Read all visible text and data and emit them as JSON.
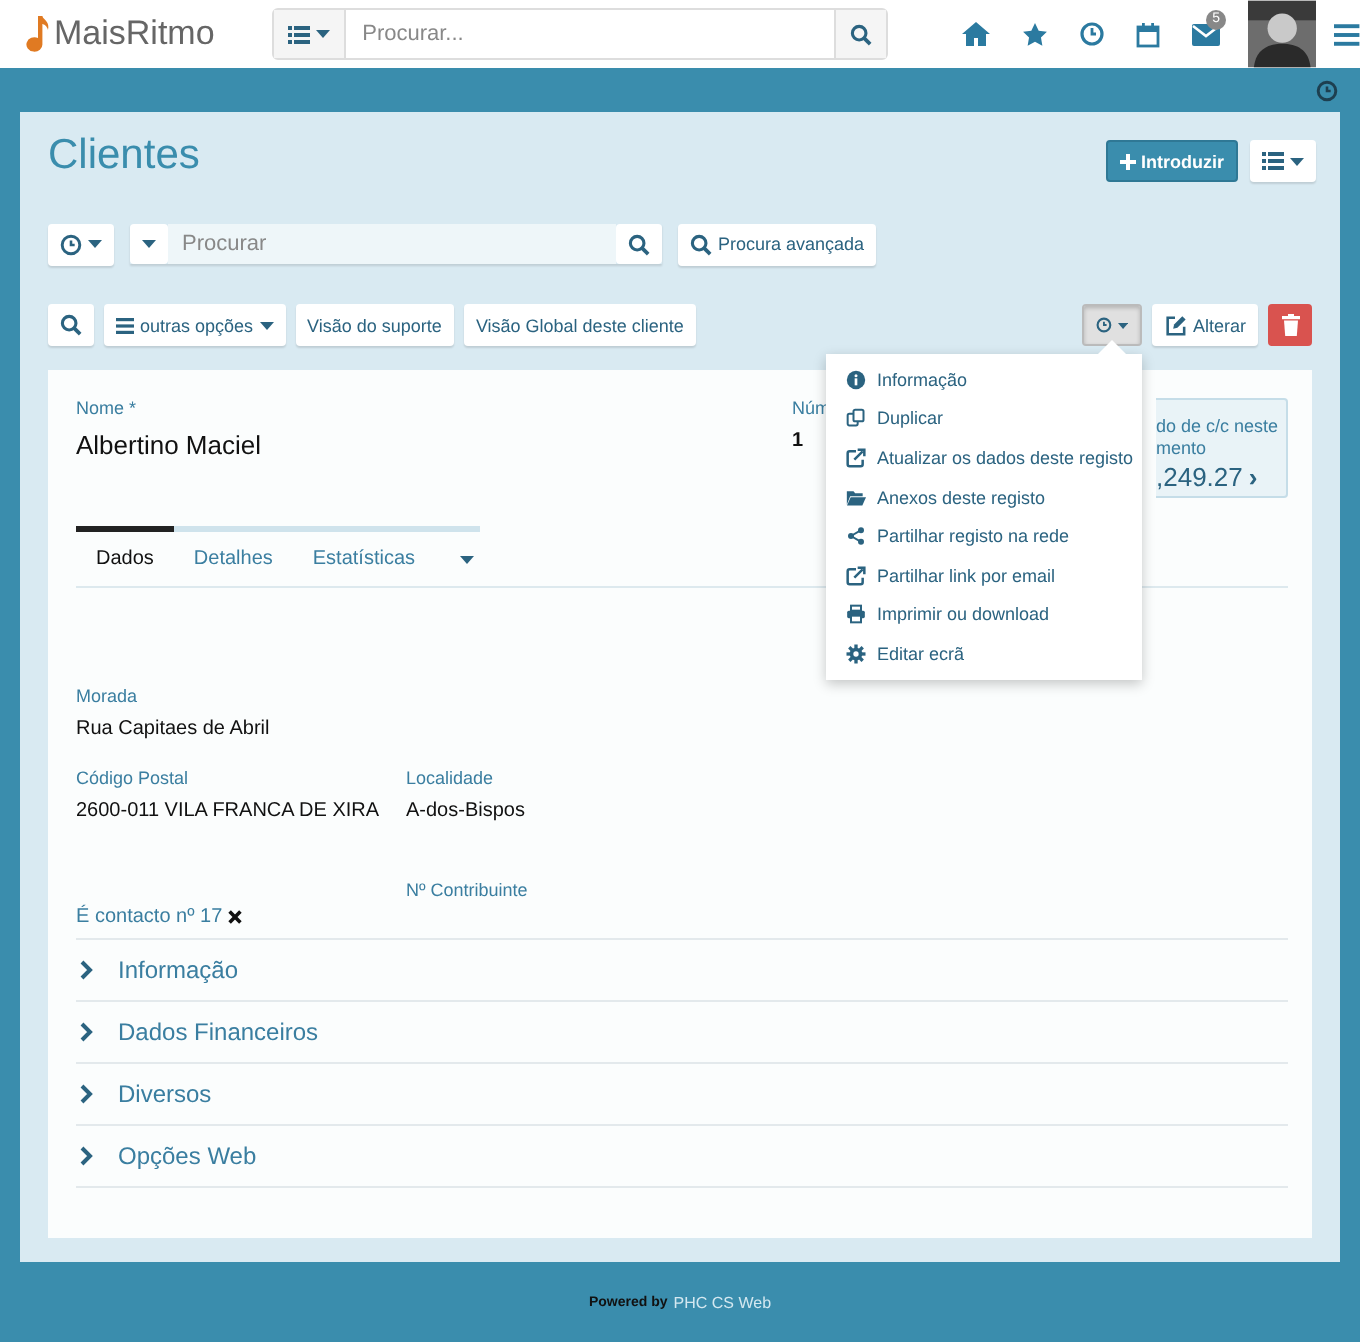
{
  "brand": {
    "name": "MaisRitmo"
  },
  "topbar": {
    "search_placeholder": "Procurar...",
    "mail_badge": "5"
  },
  "page": {
    "title": "Clientes",
    "new_button": "Introduzir"
  },
  "search": {
    "placeholder": "Procurar",
    "advanced_button": "Procura avançada"
  },
  "toolbar": {
    "options_button": "outras opções",
    "buttons": [
      "Visão do suporte",
      "Visão Global deste cliente"
    ],
    "actions_menu_open": true,
    "edit_button": "Alterar"
  },
  "menu": [
    {
      "kind": "info",
      "label": "Informação"
    },
    {
      "kind": "copy",
      "label": "Duplicar"
    },
    {
      "kind": "export",
      "label": "Atualizar os dados deste registo"
    },
    {
      "kind": "folder",
      "label": "Anexos deste registo"
    },
    {
      "kind": "share",
      "label": "Partilhar registo na rede"
    },
    {
      "kind": "export",
      "label": "Partilhar link por email"
    },
    {
      "kind": "print",
      "label": "Imprimir ou download"
    },
    {
      "kind": "gear",
      "label": "Editar ecrã"
    }
  ],
  "record": {
    "name_label": "Nome *",
    "name": "Albertino Maciel",
    "number_label": "Núm",
    "number": "1",
    "balance_label": [
      "do de c/c neste",
      "mento"
    ],
    "balance": ",249.27",
    "balance_arrow": "›"
  },
  "tabs": [
    {
      "label": "Dados",
      "selected": true
    },
    {
      "label": "Detalhes",
      "selected": false
    },
    {
      "label": "Estatísticas",
      "selected": false
    }
  ],
  "fields": [
    {
      "label": "Morada",
      "value": "Rua Capitaes de Abril"
    },
    {
      "label": "Código Postal",
      "value": "2600-011 VILA FRANCA DE XIRA"
    },
    {
      "label": "Localidade",
      "value": "A-dos-Bispos"
    },
    {
      "label": "Nº Contribuinte"
    }
  ],
  "contact": {
    "text": "É contacto nº 17"
  },
  "sections": [
    {
      "label": "Informação",
      "expanded": false
    },
    {
      "label": "Dados Financeiros",
      "expanded": false
    },
    {
      "label": "Diversos",
      "expanded": false
    },
    {
      "label": "Opções Web",
      "expanded": false
    }
  ],
  "footer": {
    "prefix": "Powered by",
    "product": "PHC CS Web"
  }
}
